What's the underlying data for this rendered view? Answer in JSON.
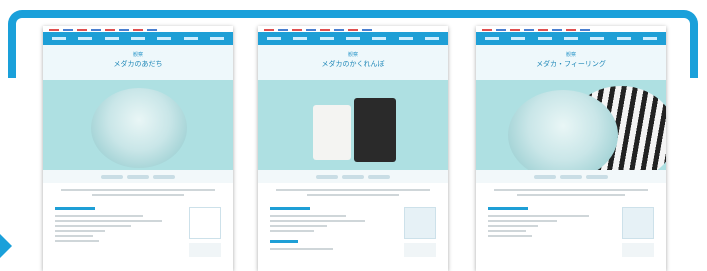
{
  "accent_color": "#1aa0da",
  "cards": [
    {
      "kicker": "観察",
      "title": "メダカのあだち"
    },
    {
      "kicker": "観察",
      "title": "メダカのかくれんぼ"
    },
    {
      "kicker": "観察",
      "title": "メダカ・フィーリング"
    }
  ]
}
